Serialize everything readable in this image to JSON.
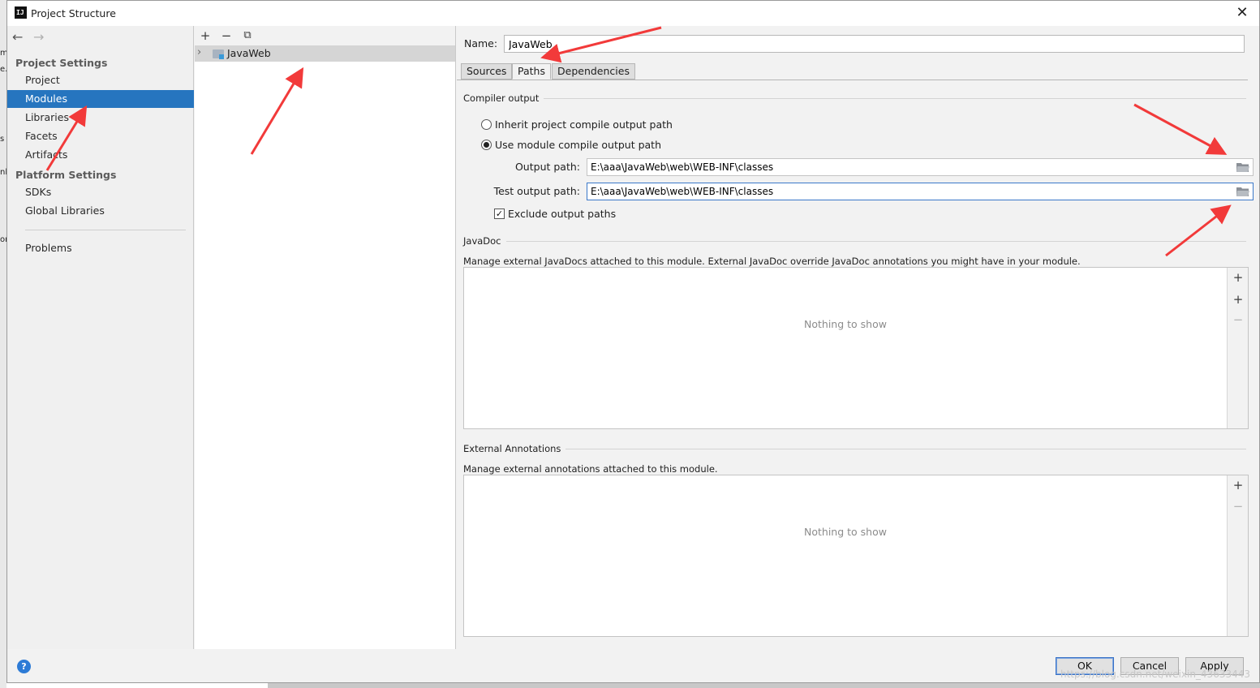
{
  "desktop": {
    "fragments": [
      "m",
      "e.",
      "s",
      "nl",
      "or"
    ]
  },
  "window": {
    "title": "Project Structure",
    "icon_text": "IJ",
    "close_glyph": "✕"
  },
  "sidebar": {
    "back_glyph": "←",
    "forward_glyph": "→",
    "project_settings_title": "Project Settings",
    "project_items": [
      "Project",
      "Modules",
      "Libraries",
      "Facets",
      "Artifacts"
    ],
    "selected": "Modules",
    "platform_settings_title": "Platform Settings",
    "platform_items": [
      "SDKs",
      "Global Libraries"
    ],
    "problems": "Problems"
  },
  "modules": {
    "toolbar": {
      "add": "+",
      "remove": "−",
      "copy": "⧉"
    },
    "tree_chevron": "›",
    "items": [
      "JavaWeb"
    ]
  },
  "detail": {
    "name_label": "Name:",
    "name_value": "JavaWeb",
    "tabs": [
      "Sources",
      "Paths",
      "Dependencies"
    ],
    "active_tab": "Paths",
    "compiler_output": {
      "title": "Compiler output",
      "inherit_label": "Inherit project compile output path",
      "use_module_label": "Use module compile output path",
      "selected": "use_module",
      "output_path_label": "Output path:",
      "output_path_value": "E:\\aaa\\JavaWeb\\web\\WEB-INF\\classes",
      "test_output_path_label": "Test output path:",
      "test_output_path_value": "E:\\aaa\\JavaWeb\\web\\WEB-INF\\classes",
      "exclude_label": "Exclude output paths",
      "exclude_checked": true,
      "check_glyph": "✓"
    },
    "javadoc": {
      "title": "JavaDoc",
      "description": "Manage external JavaDocs attached to this module. External JavaDoc override JavaDoc annotations you might have in your module.",
      "empty_text": "Nothing to show",
      "add": "+",
      "add_url": "+",
      "remove": "−"
    },
    "external_annotations": {
      "title": "External Annotations",
      "description": "Manage external annotations attached to this module.",
      "empty_text": "Nothing to show",
      "add": "+",
      "remove": "−"
    }
  },
  "footer": {
    "help": "?",
    "ok": "OK",
    "cancel": "Cancel",
    "apply": "Apply",
    "watermark": "https://blog.csdn.net/weixin_43633443"
  },
  "colors": {
    "selection": "#2675bf",
    "annotation_arrow": "#f23a3a"
  }
}
